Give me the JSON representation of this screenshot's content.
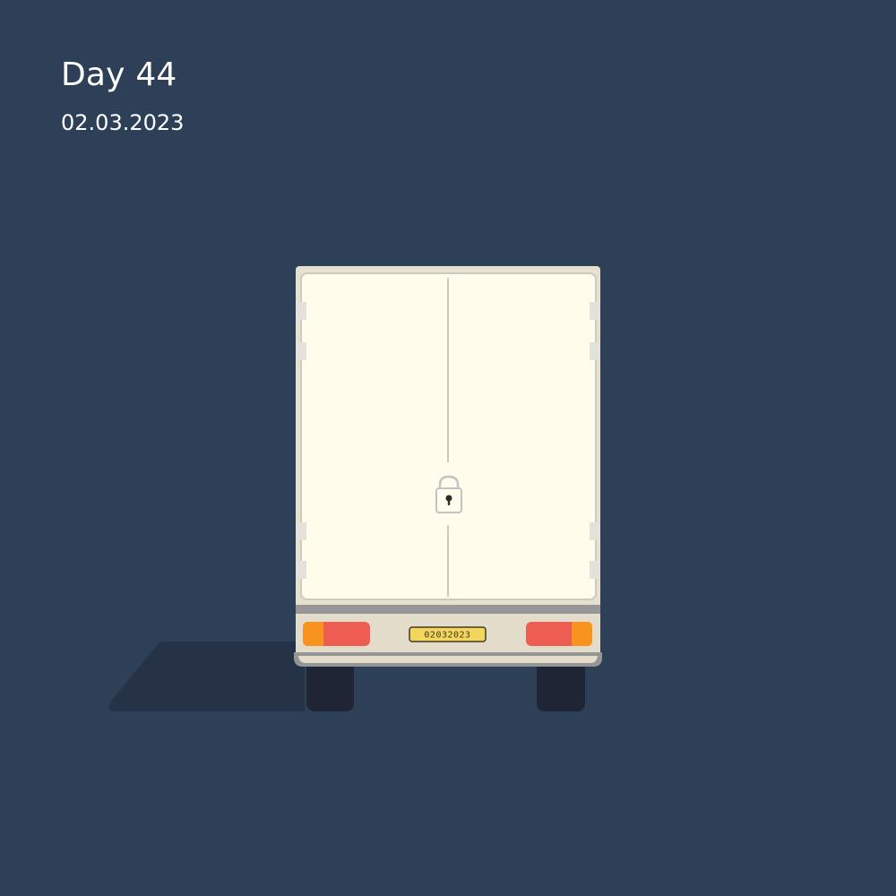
{
  "header": {
    "title": "Day 44",
    "date": "02.03.2023"
  },
  "truck": {
    "license_plate": "02032023",
    "door_state": "locked"
  },
  "icons": {
    "lock": "padlock-icon"
  },
  "colors": {
    "background": "#2e3f58",
    "shadow": "#263246",
    "body": "#fffcec",
    "frame": "#e5e0cf",
    "bumper": "#e3dccb",
    "tail_light_red": "#ee5d52",
    "tail_light_amber": "#f8931f",
    "plate": "#f3d65a",
    "tyre": "#1f2535"
  }
}
